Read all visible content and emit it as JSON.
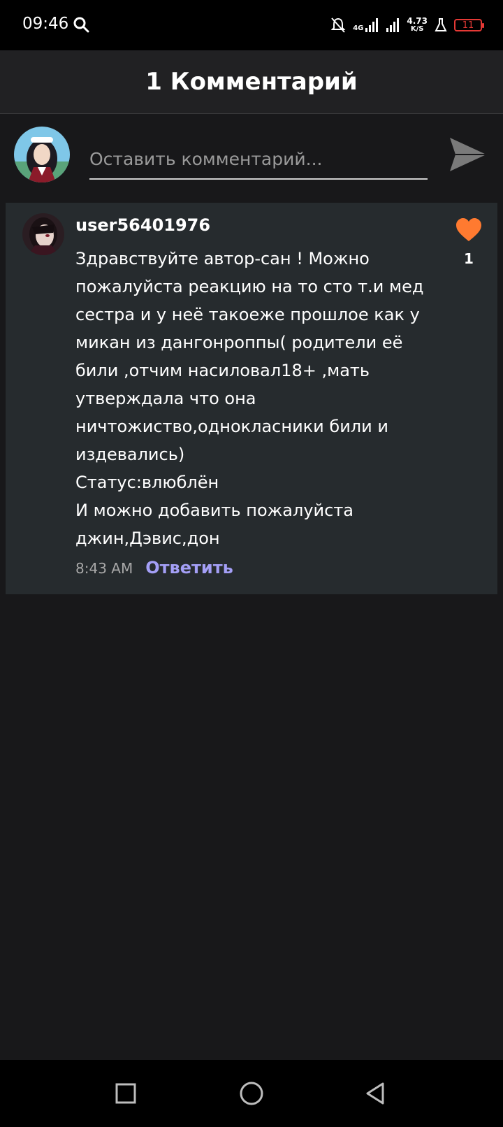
{
  "status_bar": {
    "time": "09:46",
    "network": "4G",
    "speed_value": "4.73",
    "speed_unit": "K/S",
    "battery": "11"
  },
  "header": {
    "title": "1 Комментарий"
  },
  "composer": {
    "placeholder": "Оставить комментарий..."
  },
  "comments": [
    {
      "username": "user56401976",
      "text": "Здравствуйте автор-сан ! Можно пожалуйста реакцию на то сто т.и мед сестра и у неё такоеже прошлое как у микан из дангонроппы( родители её били ,отчим насиловал18+ ,мать утверждала что она ничтожиство,однокласники били и издевались)\nСтатус:влюблён\nИ можно добавить пожалуйста джин,Дэвис,дон",
      "time": "8:43 AM",
      "reply_label": "Ответить",
      "likes": "1"
    }
  ],
  "colors": {
    "accent": "#a49ff6",
    "like": "#ff7a30",
    "background": "#18181a",
    "card": "#262b2e"
  },
  "icons": [
    "search-icon",
    "bell-off-icon",
    "signal-icon",
    "flask-icon",
    "battery-icon",
    "send-icon",
    "heart-icon",
    "square-icon",
    "circle-icon",
    "back-triangle-icon"
  ]
}
